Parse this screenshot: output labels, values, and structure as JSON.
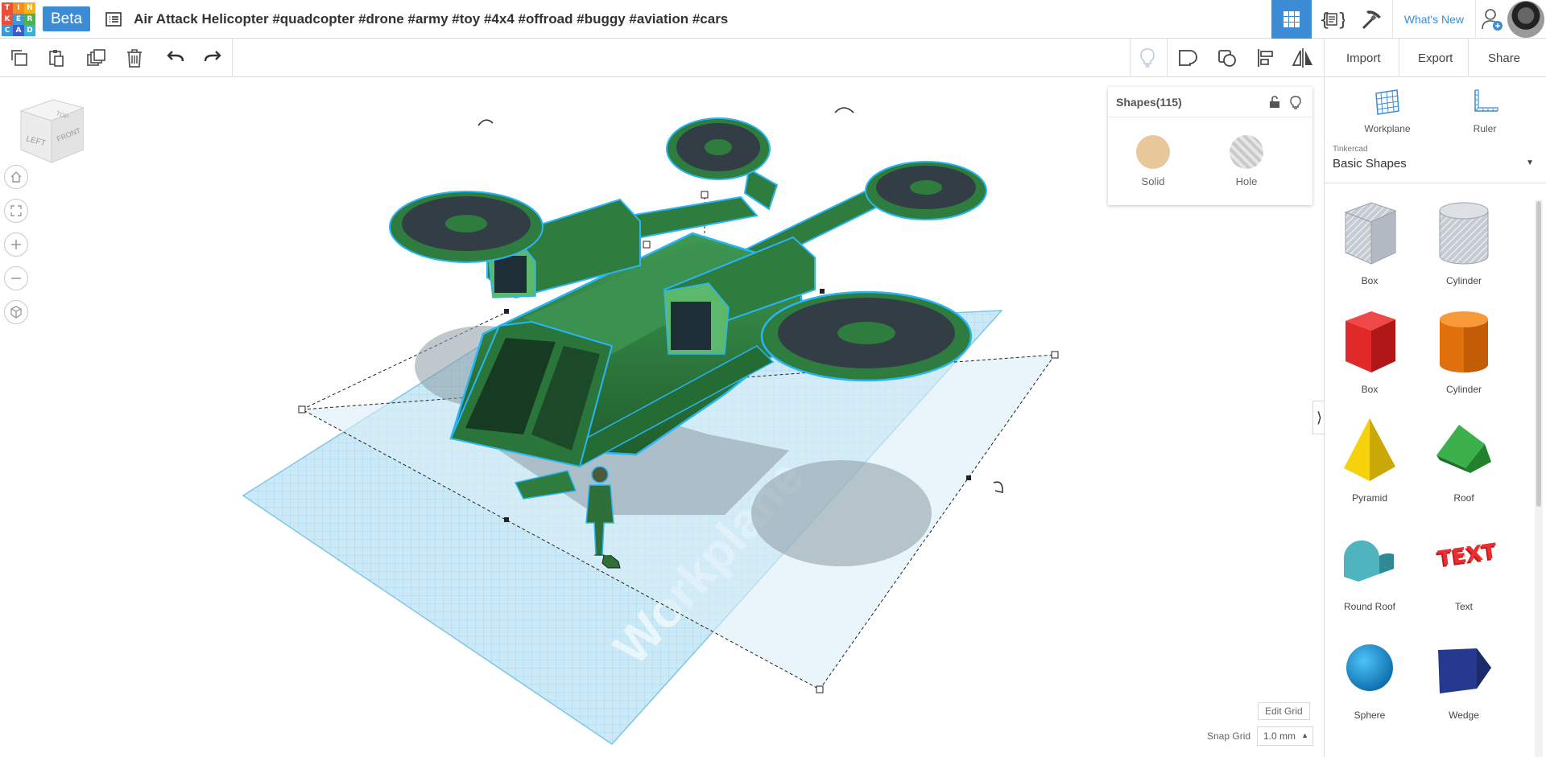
{
  "header": {
    "logo_letters": [
      "T",
      "I",
      "N",
      "K",
      "E",
      "R",
      "C",
      "A",
      "D"
    ],
    "logo_colors": [
      "#e94f3a",
      "#f48c24",
      "#f4b21b",
      "#e94f3a",
      "#3a9ad9",
      "#4caf50",
      "#3a9ad9",
      "#3c5bd1",
      "#3ab0d4"
    ],
    "beta_label": "Beta",
    "title": "Air Attack Helicopter #quadcopter #drone #army #toy #4x4 #offroad #buggy #aviation #cars",
    "whats_new": "What's New"
  },
  "toolbar": {
    "import_label": "Import",
    "export_label": "Export",
    "share_label": "Share"
  },
  "view_cube": {
    "top": "TOP",
    "left": "LEFT",
    "front": "FRONT"
  },
  "inspector": {
    "title": "Shapes(115)",
    "solid_label": "Solid",
    "hole_label": "Hole",
    "solid_color": "#e8c79a"
  },
  "workplane_watermark": "Workplane",
  "grid_controls": {
    "edit_grid_label": "Edit Grid",
    "snap_label": "Snap Grid",
    "snap_value": "1.0 mm"
  },
  "right_panel": {
    "workplane_label": "Workplane",
    "ruler_label": "Ruler",
    "library_source": "Tinkercad",
    "library_name": "Basic Shapes",
    "shapes": [
      {
        "label": "Box",
        "icon": "box-hole-icon"
      },
      {
        "label": "Cylinder",
        "icon": "cylinder-hole-icon"
      },
      {
        "label": "Box",
        "icon": "box-red-icon"
      },
      {
        "label": "Cylinder",
        "icon": "cylinder-orange-icon"
      },
      {
        "label": "Pyramid",
        "icon": "pyramid-icon"
      },
      {
        "label": "Roof",
        "icon": "roof-icon"
      },
      {
        "label": "Round Roof",
        "icon": "round-roof-icon"
      },
      {
        "label": "Text",
        "icon": "text-shape-icon"
      },
      {
        "label": "Sphere",
        "icon": "sphere-icon"
      },
      {
        "label": "Wedge",
        "icon": "wedge-icon"
      }
    ]
  },
  "colors": {
    "accent": "#3c8bd5",
    "model_green": "#2e7d3e",
    "selection_outline": "#29b6f6",
    "workplane": "#bfe4f5"
  }
}
